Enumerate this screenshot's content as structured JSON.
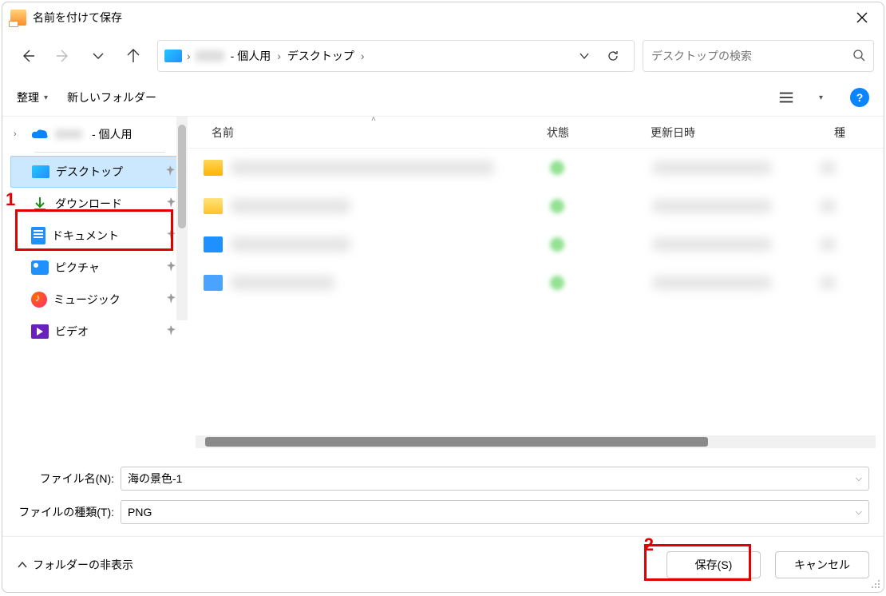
{
  "title": "名前を付けて保存",
  "breadcrumb": {
    "user_suffix": "- 個人用",
    "desktop": "デスクトップ"
  },
  "search": {
    "placeholder": "デスクトップの検索"
  },
  "toolbar": {
    "organize": "整理",
    "new_folder": "新しいフォルダー"
  },
  "sidebar": {
    "top_suffix": "- 個人用",
    "items": [
      {
        "label": "デスクトップ"
      },
      {
        "label": "ダウンロード"
      },
      {
        "label": "ドキュメント"
      },
      {
        "label": "ピクチャ"
      },
      {
        "label": "ミュージック"
      },
      {
        "label": "ビデオ"
      }
    ]
  },
  "columns": {
    "name": "名前",
    "status": "状態",
    "date": "更新日時",
    "kind": "種"
  },
  "filename": {
    "name_label": "ファイル名(N):",
    "name_value": "海の景色-1",
    "type_label": "ファイルの種類(T):",
    "type_value": "PNG"
  },
  "bottom": {
    "hide_folders": "フォルダーの非表示",
    "save": "保存(S)",
    "cancel": "キャンセル"
  },
  "annotations": {
    "n1": "1",
    "n2": "2"
  }
}
